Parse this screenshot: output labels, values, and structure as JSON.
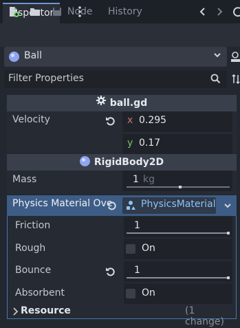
{
  "tabs": [
    {
      "label": "Inspector"
    },
    {
      "label": "Node"
    },
    {
      "label": "History"
    }
  ],
  "object_selector": {
    "label": "Ball"
  },
  "filter": {
    "placeholder": "Filter Properties"
  },
  "script_section": {
    "label": "ball.gd"
  },
  "velocity": {
    "label": "Velocity",
    "x_axis": "x",
    "x_value": "0.295",
    "y_axis": "y",
    "y_value": "0.17"
  },
  "rigidbody_section": {
    "label": "RigidBody2D"
  },
  "mass": {
    "label": "Mass",
    "value": "1",
    "unit": "kg",
    "slider_fraction": 0.52
  },
  "physics_override": {
    "label": "Physics Material Ove",
    "resource_label": "PhysicsMaterial"
  },
  "friction": {
    "label": "Friction",
    "value": "1"
  },
  "rough": {
    "label": "Rough",
    "value_label": "On"
  },
  "bounce": {
    "label": "Bounce",
    "value": "1"
  },
  "absorbent": {
    "label": "Absorbent",
    "value_label": "On"
  },
  "resource_row": {
    "label": "Resource",
    "changes": "(1 change)"
  },
  "colors": {
    "accent": "#6f97d3",
    "override_header": "#3d5d86",
    "axis_x": "#c4796e",
    "axis_y": "#7fbf6a"
  }
}
